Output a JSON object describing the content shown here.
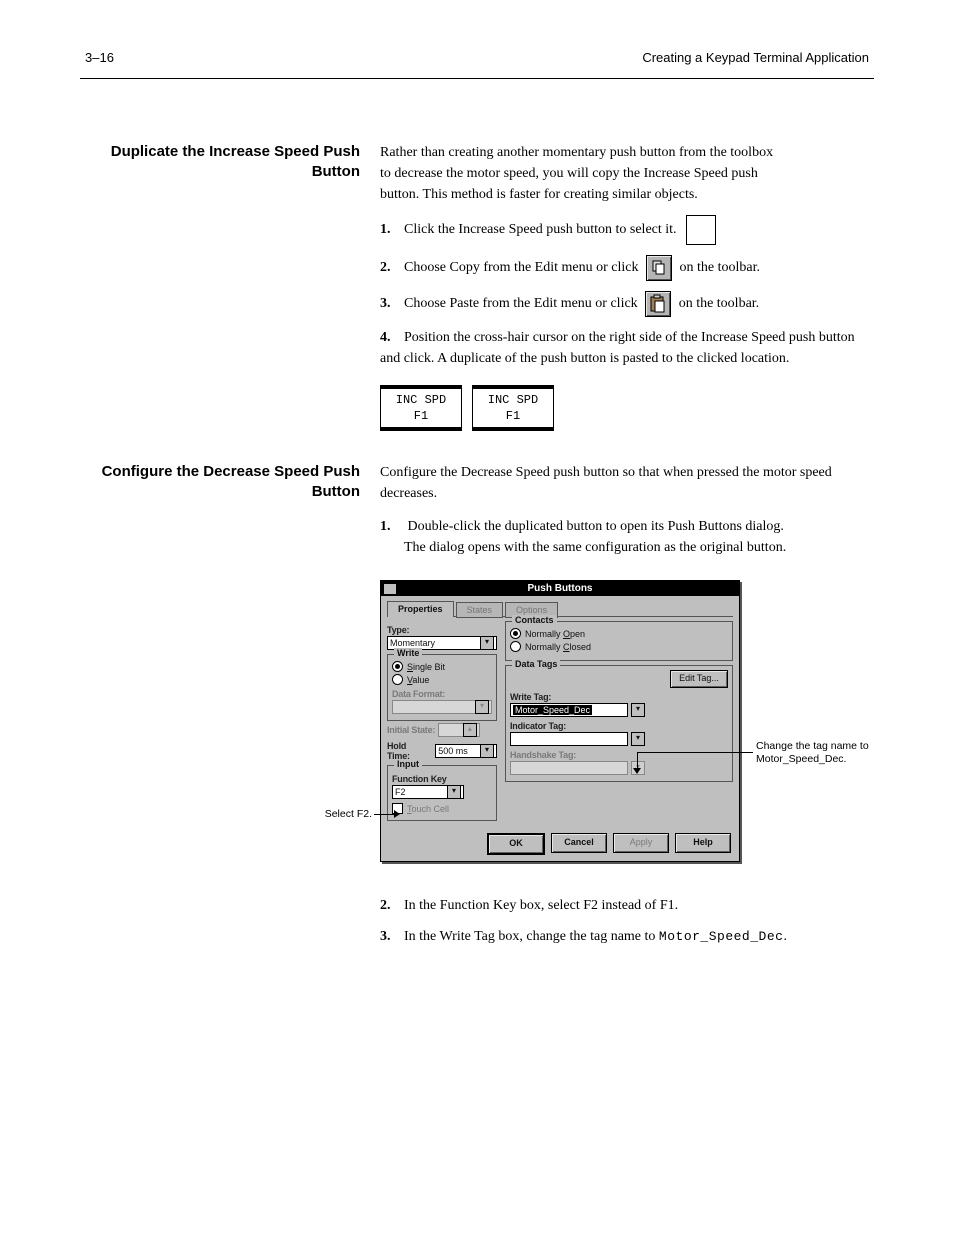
{
  "header": {
    "left": "3–16",
    "right_line1": "Creating a Keypad Terminal Application",
    "right_line2": ""
  },
  "sections": {
    "dup_title": "Duplicate the Increase Speed Push Button",
    "dup_intro": "Rather than creating another momentary push button from the toolbox\nto decrease the motor speed, you will copy the Increase Speed push\nbutton. This method is faster for creating similar objects.",
    "dup_step1": "Click the Increase Speed push button to select it.",
    "dup_step2_a": "Choose Copy from the Edit menu or click ",
    "dup_step2_b": " on the toolbar.",
    "dup_step3_a": "Choose Paste from the Edit menu or click ",
    "dup_step3_b": " on the toolbar.",
    "dup_step4": "Position the cross-hair cursor on the right side of the Increase Speed push button and click. A duplicate of the push button is pasted to the clicked location.",
    "config_title": "Configure the Decrease Speed Push Button",
    "config_intro": "Configure the Decrease Speed push button so that when pressed the motor speed decreases.",
    "config_step1_line1": "Double-click the duplicated button to open its Push Buttons dialog.",
    "config_step1_line2": "The dialog opens with the same configuration as the original button.",
    "config_step2": "In the Function Key box, select F2 instead of F1.",
    "config_step3_a": "In the Write Tag box, change the tag name to ",
    "config_step3_b": ".",
    "tagname": "Motor_Speed_Dec"
  },
  "btn_illustration": {
    "label_line1": "INC SPD",
    "label_line2": "F1"
  },
  "dialog": {
    "title": "Push Buttons",
    "tabs": {
      "properties": "Properties",
      "states": "States",
      "options": "Options"
    },
    "type_label": "Type:",
    "type_value": "Momentary",
    "write_group": "Write",
    "write_single": "Single Bit",
    "write_value": "Value",
    "data_format_label": "Data Format:",
    "initial_state_label": "Initial State:",
    "hold_time_label": "Hold Time:",
    "hold_time_value": "500 ms",
    "input_group": "Input",
    "function_key_label": "Function Key",
    "function_key_value": "F2",
    "touch_cell": "Touch Cell",
    "contacts_group": "Contacts",
    "contacts_open": "Normally Open",
    "contacts_closed": "Normally Closed",
    "data_tags_group": "Data Tags",
    "edit_tag_btn": "Edit Tag...",
    "write_tag_label": "Write Tag:",
    "write_tag_value": "Motor_Speed_Dec",
    "indicator_tag_label": "Indicator Tag:",
    "handshake_tag_label": "Handshake Tag:",
    "buttons": {
      "ok": "OK",
      "cancel": "Cancel",
      "apply": "Apply",
      "help": "Help"
    }
  },
  "callouts": {
    "fkey": "Select F2.",
    "wtag_l1": "Change the tag name to",
    "wtag_l2": "Motor_Speed_Dec."
  }
}
